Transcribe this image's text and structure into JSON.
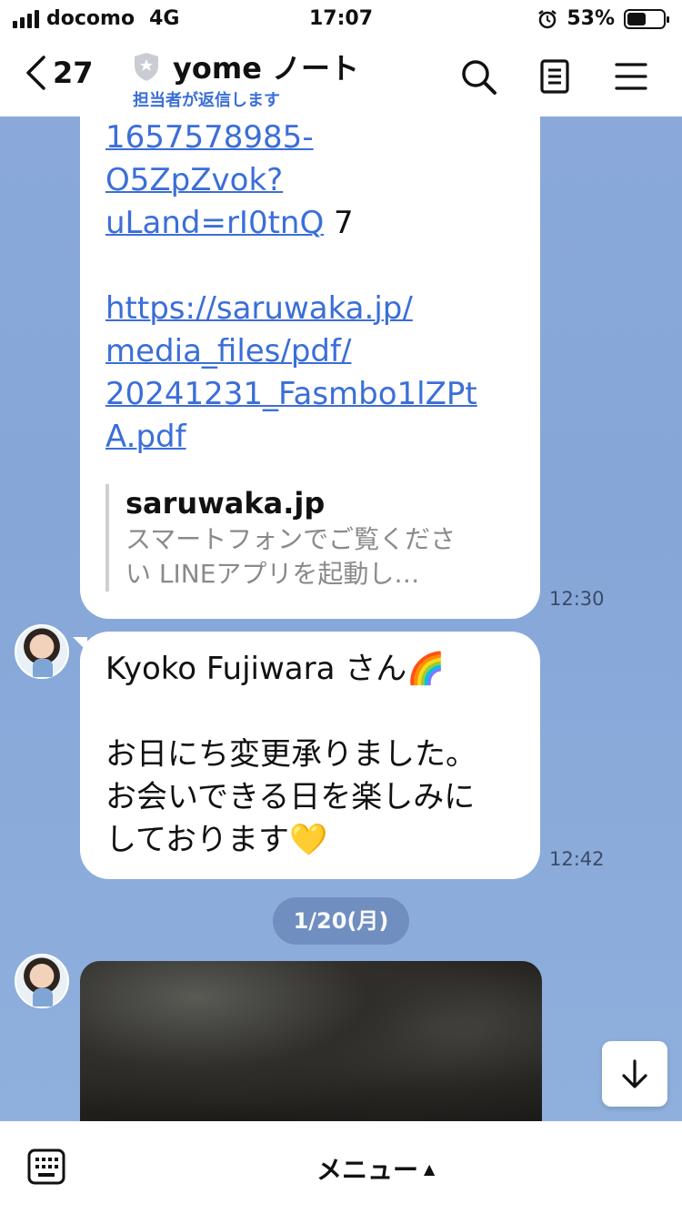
{
  "status_bar": {
    "carrier": "docomo",
    "network": "4G",
    "time": "17:07",
    "battery_percent": "53%",
    "battery_level": 0.53
  },
  "header": {
    "back_count": "27",
    "title": "yome ノート",
    "subtitle": "担当者が返信します"
  },
  "messages": {
    "msg1": {
      "link_lines": [
        "1657578985-",
        "O5ZpZvok?",
        "uLand=rI0tnQ"
      ],
      "after_link": " 7",
      "url_lines": [
        "https://saruwaka.jp/",
        "media_files/pdf/",
        "20241231_Fasmbo1lZPt",
        "A.pdf"
      ],
      "preview_title": "saruwaka.jp",
      "preview_desc_1": "スマートフォンでご覧くださ",
      "preview_desc_2": "い LINEアプリを起動し…",
      "time": "12:30"
    },
    "msg2": {
      "line1": "Kyoko Fujiwara さん🌈",
      "line2": "お日にち変更承りました。",
      "line3": "お会いできる日を楽しみに",
      "line4": "しております💛",
      "time": "12:42"
    },
    "date_separator": "1/20(月)"
  },
  "bottom_bar": {
    "menu_label": "メニュー",
    "menu_arrow": "▲"
  },
  "colors": {
    "chat_bg": "#8aa9da",
    "link": "#3b6ed8",
    "subtitle": "#3a6fd8"
  }
}
